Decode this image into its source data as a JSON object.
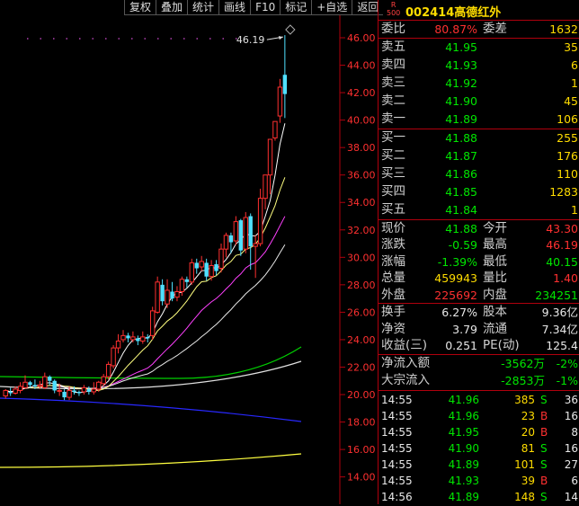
{
  "toolbar": [
    "复权",
    "叠加",
    "统计",
    "画线",
    "F10",
    "标记",
    "+自选",
    "返回"
  ],
  "header": {
    "badge_r": "R",
    "badge_num": "500",
    "code": "002414",
    "name": "高德红外"
  },
  "ratio": {
    "label1": "委比",
    "value1": "80.87%",
    "label2": "委差",
    "value2": "1632"
  },
  "asks": [
    {
      "label": "卖五",
      "price": "41.95",
      "vol": "35"
    },
    {
      "label": "卖四",
      "price": "41.93",
      "vol": "6"
    },
    {
      "label": "卖三",
      "price": "41.92",
      "vol": "1"
    },
    {
      "label": "卖二",
      "price": "41.90",
      "vol": "45"
    },
    {
      "label": "卖一",
      "price": "41.89",
      "vol": "106"
    }
  ],
  "bids": [
    {
      "label": "买一",
      "price": "41.88",
      "vol": "255"
    },
    {
      "label": "买二",
      "price": "41.87",
      "vol": "176"
    },
    {
      "label": "买三",
      "price": "41.86",
      "vol": "110"
    },
    {
      "label": "买四",
      "price": "41.85",
      "vol": "1283"
    },
    {
      "label": "买五",
      "price": "41.84",
      "vol": "1"
    }
  ],
  "quote": [
    {
      "l1": "现价",
      "v1": "41.88",
      "c1": "green",
      "l2": "今开",
      "v2": "43.30",
      "c2": "red"
    },
    {
      "l1": "涨跌",
      "v1": "-0.59",
      "c1": "green",
      "l2": "最高",
      "v2": "46.19",
      "c2": "red"
    },
    {
      "l1": "涨幅",
      "v1": "-1.39%",
      "c1": "green",
      "l2": "最低",
      "v2": "40.15",
      "c2": "green"
    },
    {
      "l1": "总量",
      "v1": "459943",
      "c1": "yel",
      "l2": "量比",
      "v2": "1.40",
      "c2": "red"
    },
    {
      "l1": "外盘",
      "v1": "225692",
      "c1": "red",
      "l2": "内盘",
      "v2": "234251",
      "c2": "green"
    }
  ],
  "fundamentals": [
    {
      "l1": "换手",
      "v1": "6.27%",
      "l2": "股本",
      "v2": "9.36亿"
    },
    {
      "l1": "净资",
      "v1": "3.79",
      "l2": "流通",
      "v2": "7.34亿"
    },
    {
      "l1": "收益(三)",
      "v1": "0.251",
      "l2": "PE(动)",
      "v2": "125.4"
    }
  ],
  "flow": [
    {
      "label": "净流入额",
      "value": "-3562万",
      "pct": "-2%"
    },
    {
      "label": "大宗流入",
      "value": "-2853万",
      "pct": "-1%"
    }
  ],
  "ticks": [
    {
      "time": "14:55",
      "price": "41.96",
      "vol": "385",
      "side": "S",
      "num": "36"
    },
    {
      "time": "14:55",
      "price": "41.96",
      "vol": "23",
      "side": "B",
      "num": "16"
    },
    {
      "time": "14:55",
      "price": "41.95",
      "vol": "20",
      "side": "B",
      "num": "8"
    },
    {
      "time": "14:55",
      "price": "41.90",
      "vol": "81",
      "side": "S",
      "num": "16"
    },
    {
      "time": "14:55",
      "price": "41.89",
      "vol": "101",
      "side": "S",
      "num": "27"
    },
    {
      "time": "14:55",
      "price": "41.93",
      "vol": "39",
      "side": "B",
      "num": "6"
    },
    {
      "time": "14:56",
      "price": "41.89",
      "vol": "148",
      "side": "S",
      "num": "14"
    }
  ],
  "colors": {
    "up": "#ff3030",
    "down": "#00e600",
    "ma5": "#ffffff",
    "ma10": "#ffff80",
    "ma20": "#ff40ff",
    "ma30": "#ffffff",
    "ma60": "#00d000",
    "ma120": "#e0e0e0",
    "ma250": "#2828ff",
    "ma_long": "#ffff40",
    "cyan_bar": "#50e0ff"
  },
  "chart_data": {
    "type": "candlestick",
    "y_ticks": [
      "46.00",
      "44.00",
      "42.00",
      "40.00",
      "38.00",
      "36.00",
      "34.00",
      "32.00",
      "30.00",
      "28.00",
      "26.00",
      "24.00",
      "22.00",
      "20.00",
      "18.00",
      "16.00",
      "14.00"
    ],
    "ylim": [
      13,
      47
    ],
    "high_label": "46.19",
    "candles": [
      [
        19.9,
        20.3,
        19.7,
        20.4
      ],
      [
        20.2,
        20.1,
        19.9,
        20.5
      ],
      [
        20.1,
        20.4,
        20.0,
        20.6
      ],
      [
        20.3,
        20.6,
        20.1,
        20.9
      ],
      [
        20.5,
        20.9,
        20.4,
        21.4
      ],
      [
        20.9,
        20.7,
        20.5,
        21.0
      ],
      [
        20.7,
        20.6,
        20.4,
        21.1
      ],
      [
        20.6,
        20.7,
        20.4,
        21.0
      ],
      [
        20.5,
        21.3,
        20.4,
        21.6
      ],
      [
        21.3,
        21.0,
        20.7,
        21.4
      ],
      [
        21.0,
        20.3,
        20.1,
        21.1
      ],
      [
        20.3,
        20.3,
        19.9,
        20.8
      ],
      [
        20.2,
        19.8,
        19.6,
        20.4
      ],
      [
        19.8,
        20.3,
        19.6,
        20.6
      ],
      [
        20.3,
        20.2,
        20.0,
        20.6
      ],
      [
        20.2,
        20.1,
        19.9,
        20.3
      ],
      [
        20.2,
        20.5,
        20.0,
        20.7
      ],
      [
        20.4,
        20.2,
        20.0,
        20.6
      ],
      [
        20.2,
        20.4,
        20.0,
        20.9
      ],
      [
        20.4,
        20.9,
        20.2,
        21.0
      ],
      [
        20.8,
        21.3,
        20.6,
        21.5
      ],
      [
        21.3,
        22.2,
        21.1,
        22.4
      ],
      [
        22.1,
        23.4,
        21.9,
        23.6
      ],
      [
        23.4,
        23.9,
        23.0,
        24.4
      ],
      [
        24.0,
        24.3,
        23.8,
        24.7
      ],
      [
        24.3,
        24.1,
        23.8,
        24.5
      ],
      [
        24.0,
        24.2,
        23.8,
        24.6
      ],
      [
        24.1,
        23.9,
        23.6,
        24.3
      ],
      [
        23.9,
        24.2,
        23.7,
        24.6
      ],
      [
        24.2,
        24.1,
        23.8,
        24.4
      ],
      [
        24.3,
        26.1,
        24.0,
        26.4
      ],
      [
        26.0,
        28.2,
        25.9,
        28.6
      ],
      [
        28.0,
        26.8,
        26.5,
        28.4
      ],
      [
        26.6,
        27.6,
        26.3,
        28.4
      ],
      [
        27.5,
        27.0,
        26.8,
        28.2
      ],
      [
        27.1,
        27.5,
        26.8,
        27.9
      ],
      [
        27.5,
        28.4,
        27.2,
        28.6
      ],
      [
        28.4,
        28.2,
        27.8,
        28.6
      ],
      [
        28.2,
        29.6,
        28.0,
        29.9
      ],
      [
        29.6,
        29.2,
        28.8,
        29.9
      ],
      [
        29.3,
        29.7,
        29.0,
        30.1
      ],
      [
        29.6,
        28.6,
        28.3,
        29.9
      ],
      [
        28.6,
        29.4,
        28.3,
        29.8
      ],
      [
        29.5,
        29.0,
        28.7,
        29.8
      ],
      [
        29.2,
        30.6,
        28.9,
        31.0
      ],
      [
        30.6,
        31.6,
        30.0,
        31.8
      ],
      [
        31.6,
        31.1,
        30.3,
        31.8
      ],
      [
        31.2,
        32.6,
        30.9,
        33.0
      ],
      [
        32.7,
        30.5,
        30.1,
        32.8
      ],
      [
        30.6,
        32.9,
        30.3,
        33.3
      ],
      [
        33.0,
        30.8,
        29.1,
        33.2
      ],
      [
        30.8,
        31.0,
        28.5,
        31.6
      ],
      [
        31.0,
        34.3,
        30.8,
        35.0
      ],
      [
        34.3,
        36.0,
        33.5,
        36.0
      ],
      [
        36.0,
        38.6,
        34.6,
        38.6
      ],
      [
        38.7,
        39.9,
        38.5,
        39.9
      ],
      [
        40.3,
        42.4,
        39.8,
        43.0
      ],
      [
        43.3,
        41.9,
        40.15,
        46.19
      ]
    ]
  }
}
